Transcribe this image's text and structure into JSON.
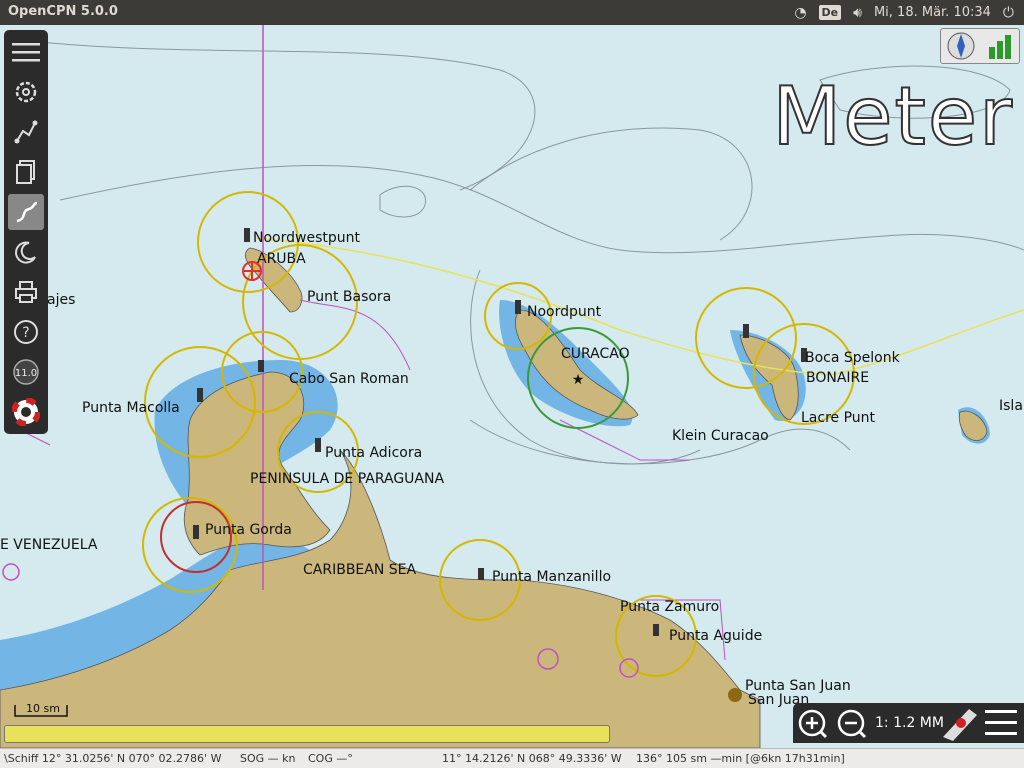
{
  "window": {
    "title": "OpenCPN 5.0.0"
  },
  "tray": {
    "keyboard": "De",
    "datetime": "Mi, 18. Mär. 10:34"
  },
  "watermark": "Meter",
  "labels": {
    "noordwestpunt": "Noordwestpunt",
    "aruba": "ARUBA",
    "punt_basora": "Punt Basora",
    "nouvajes": "ajes",
    "nordpunt": "Noordpunt",
    "curacao": "CURACAO",
    "boca_spelonk": "Boca Spelonk",
    "bonaire": "BONAIRE",
    "lacre_punt": "Lacre Punt",
    "klein_curacao": "Klein Curacao",
    "isla": "Isla",
    "cabo_san_roman": "Cabo San Roman",
    "punta_macolla": "Punta Macolla",
    "punta_adicora": "Punta Adicora",
    "peninsula": "PENINSULA DE PARAGUANA",
    "punta_gorda": "Punta Gorda",
    "venezuela": "E VENEZUELA",
    "caribbean": "CARIBBEAN SEA",
    "punta_manzanillo": "Punta Manzanillo",
    "punta_zamuro": "Punta Zamuro",
    "punta_aguide": "Punta Aguide",
    "punta_san_juan": "Punta San Juan",
    "san_juan": "San Juan"
  },
  "scale": {
    "bar": "10 sm"
  },
  "zoombar": {
    "scale": "1: 1.2 MM"
  },
  "toolbar": {
    "badge": "11.0"
  },
  "statusbar": {
    "ship": "\\Schiff 12° 31.0256' N   070° 02.2786' W",
    "sog": "SOG — kn",
    "cog": "COG —°",
    "cursor": "11° 14.2126' N   068° 49.3336' W",
    "bearing": "136°   105 sm  —min  [@6kn 17h31min]"
  },
  "colors": {
    "sea": "#d4eaee",
    "shallow": "#73b6e6",
    "land": "#cbb67c",
    "toolbar": "#2b2b2b"
  }
}
